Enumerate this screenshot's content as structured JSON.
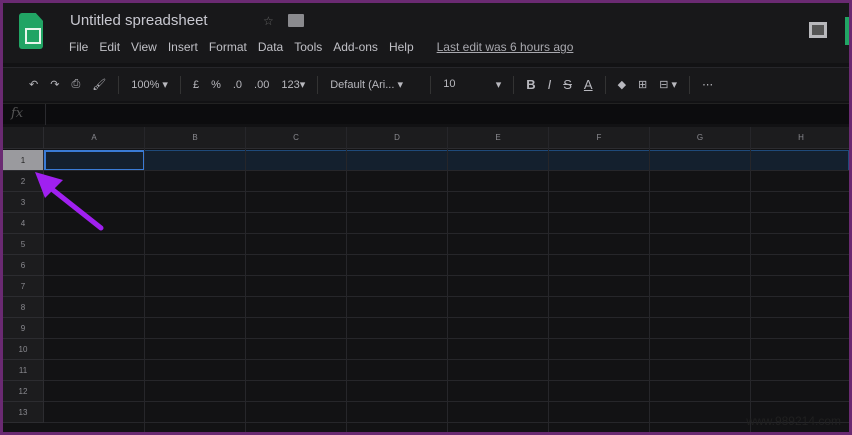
{
  "header": {
    "title": "Untitled spreadsheet",
    "star_icon": "star-icon",
    "folder_icon": "folder-icon",
    "menu": [
      "File",
      "Edit",
      "View",
      "Insert",
      "Format",
      "Data",
      "Tools",
      "Add-ons",
      "Help"
    ],
    "last_edit": "Last edit was 6 hours ago"
  },
  "toolbar": {
    "undo": "↶",
    "redo": "↷",
    "print": "⎙",
    "paint": "🖌",
    "zoom": "100%",
    "currency": "£",
    "percent": "%",
    "dec_less": ".0",
    "dec_more": ".00",
    "format_more": "123",
    "font": "Default (Ari...",
    "size": "10",
    "bold": "B",
    "italic": "I",
    "strike": "S",
    "text_color": "A",
    "more": "⋯"
  },
  "formula_bar": {
    "fx": "fx",
    "value": ""
  },
  "columns": [
    "A",
    "B",
    "C",
    "D",
    "E",
    "F",
    "G",
    "H"
  ],
  "rows": [
    "1",
    "2",
    "3",
    "4",
    "5",
    "6",
    "7",
    "8",
    "9",
    "10",
    "11",
    "12",
    "13"
  ],
  "selected_row": "1",
  "watermark": "www.989214.com",
  "colors": {
    "accent": "#3a7bd5",
    "brand": "#21a464",
    "arrow": "#a020f0"
  }
}
